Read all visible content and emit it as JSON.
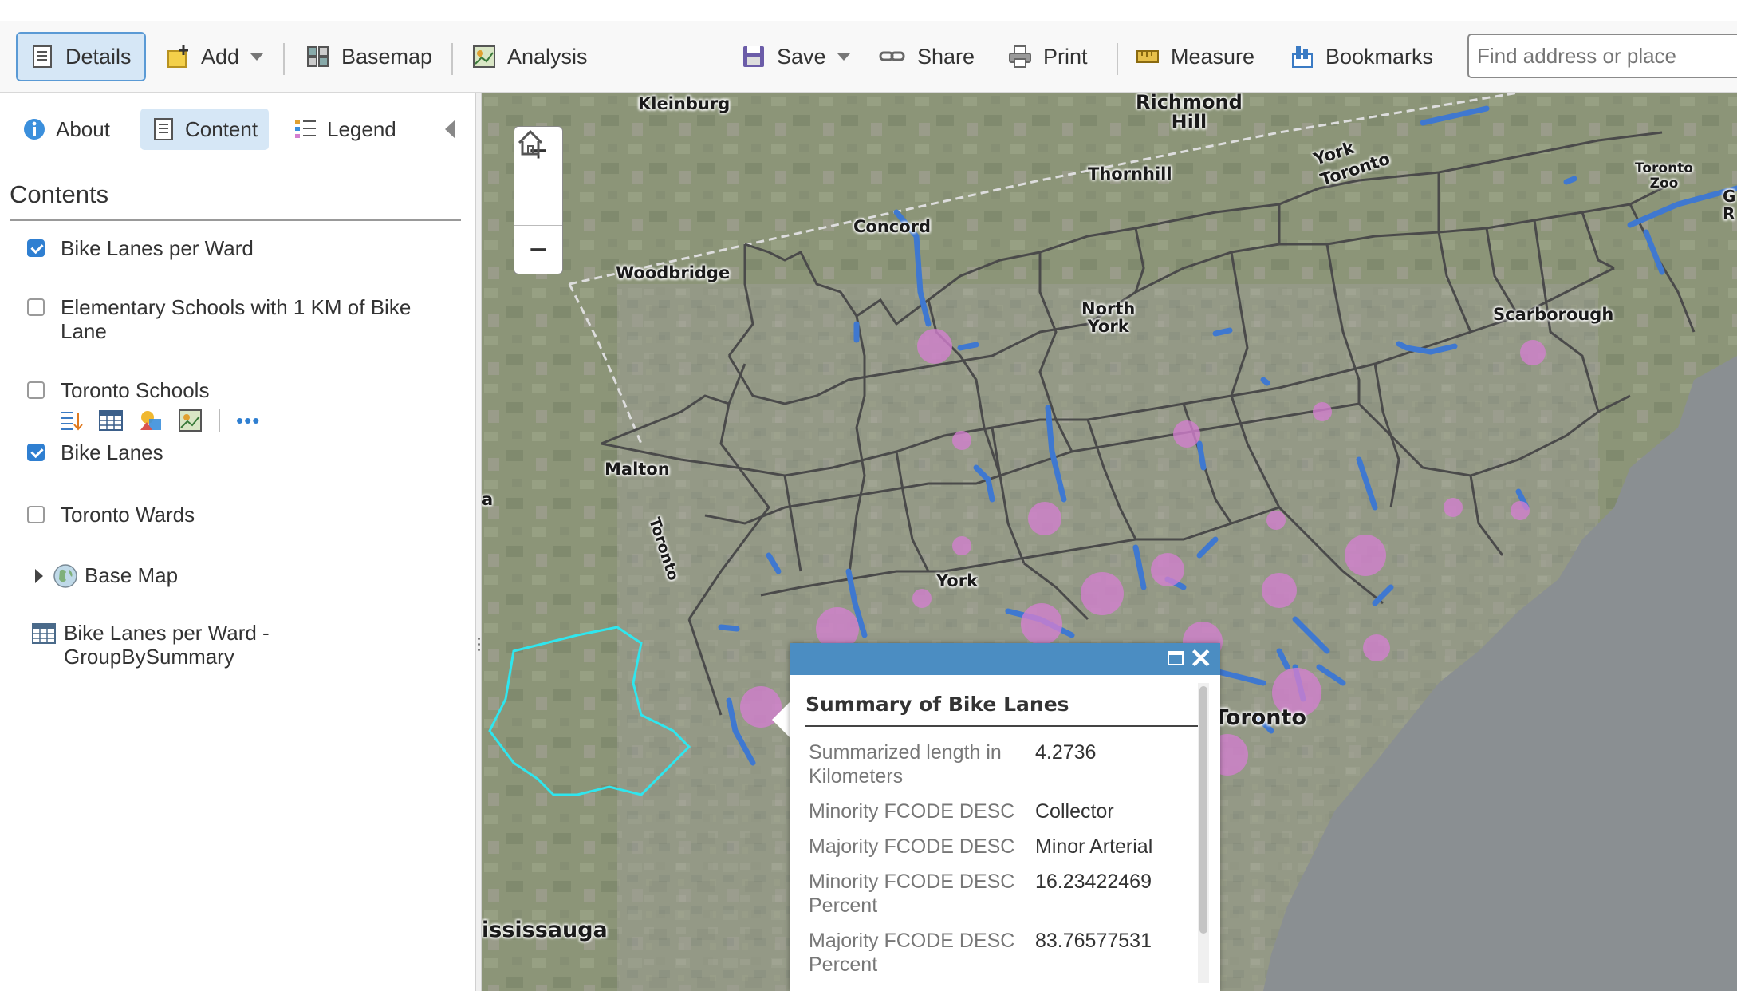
{
  "toolbar": {
    "details": "Details",
    "add": "Add",
    "basemap": "Basemap",
    "analysis": "Analysis",
    "save": "Save",
    "share": "Share",
    "print": "Print",
    "measure": "Measure",
    "bookmarks": "Bookmarks",
    "search_placeholder": "Find address or place"
  },
  "panel": {
    "tabs": {
      "about": "About",
      "content": "Content",
      "legend": "Legend"
    },
    "contents_title": "Contents",
    "layers": [
      {
        "label": "Bike Lanes per Ward",
        "checked": true
      },
      {
        "label": "Elementary Schools with 1 KM of Bike Lane",
        "checked": false
      },
      {
        "label": "Toronto Schools",
        "checked": false
      },
      {
        "label": "Bike Lanes",
        "checked": true
      },
      {
        "label": "Toronto Wards",
        "checked": false
      },
      {
        "label": "Base Map"
      },
      {
        "label": "Bike Lanes per Ward - GroupBySummary"
      }
    ],
    "more_dots": "•••"
  },
  "map": {
    "places": {
      "kleinburg": "Kleinburg",
      "richmond_hill": "Richmond\nHill",
      "thornhill": "Thornhill",
      "york_toronto": "York\nToronto",
      "toronto_zoo": "Toronto\nZoo",
      "concord": "Concord",
      "woodbridge": "Woodbridge",
      "north_york": "North\nYork",
      "scarborough": "Scarborough",
      "malton": "Malton",
      "toronto_hwy": "Toronto",
      "york": "York",
      "toronto": "Toronto",
      "mississauga": "ississauga",
      "edge_a": "a",
      "edge_g": "G",
      "edge_r": "R"
    },
    "zoom": {
      "in": "+",
      "out": "−"
    },
    "colors": {
      "wards": "#4a4a4a",
      "bike_lanes": "#3f78d0",
      "summary_circles": "#d47fd0",
      "selected_ward": "#2fe6ee",
      "lake": "#8a8f92"
    }
  },
  "popup": {
    "close": "✕",
    "title": "Summary of Bike Lanes",
    "rows": [
      {
        "key": "Summarized length in Kilometers",
        "value": "4.2736"
      },
      {
        "key": "Minority FCODE DESC",
        "value": "Collector"
      },
      {
        "key": "Majority FCODE DESC",
        "value": "Minor Arterial"
      },
      {
        "key": "Minority FCODE DESC Percent",
        "value": "16.23422469"
      },
      {
        "key": "Majority FCODE DESC Percent",
        "value": "83.76577531"
      }
    ]
  }
}
